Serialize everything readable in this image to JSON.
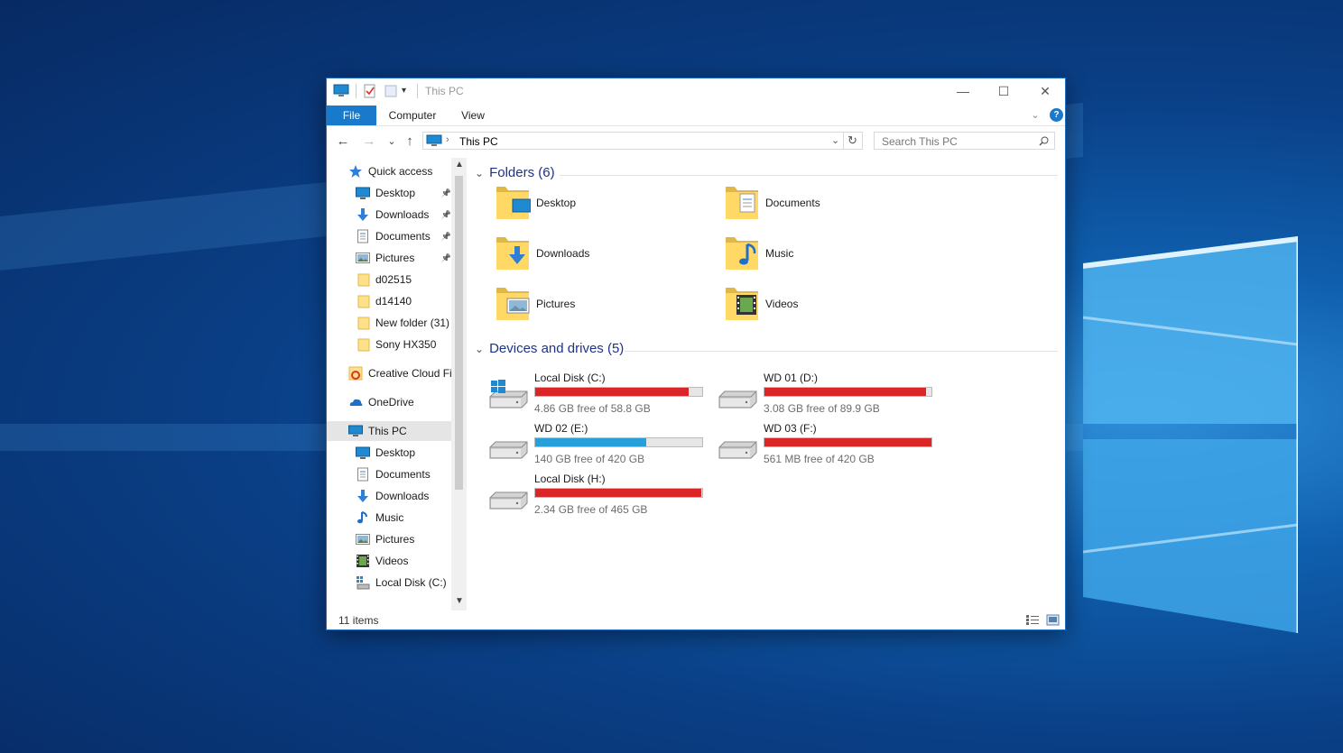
{
  "window": {
    "title": "This PC",
    "controls": {
      "minimize": "—",
      "maximize": "☐",
      "close": "✕"
    }
  },
  "ribbon": {
    "tabs": [
      "File",
      "Computer",
      "View"
    ],
    "help": "?"
  },
  "nav": {
    "back": "←",
    "forward": "→",
    "recent": "⌄",
    "up": "↑",
    "breadcrumb": "This PC",
    "refresh": "↻",
    "search_placeholder": "Search This PC"
  },
  "sidebar": {
    "items": [
      {
        "label": "Quick access",
        "icon": "star-icon",
        "level": 0
      },
      {
        "label": "Desktop",
        "icon": "desktop-icon",
        "level": 1,
        "pinned": true
      },
      {
        "label": "Downloads",
        "icon": "download-icon",
        "level": 1,
        "pinned": true
      },
      {
        "label": "Documents",
        "icon": "document-icon",
        "level": 1,
        "pinned": true
      },
      {
        "label": "Pictures",
        "icon": "picture-icon",
        "level": 1,
        "pinned": true
      },
      {
        "label": "d02515",
        "icon": "folder-icon",
        "level": 1
      },
      {
        "label": "d14140",
        "icon": "folder-icon",
        "level": 1
      },
      {
        "label": "New folder (31)",
        "icon": "folder-icon",
        "level": 1
      },
      {
        "label": "Sony HX350",
        "icon": "folder-icon",
        "level": 1
      },
      {
        "label": "Creative Cloud Fil",
        "icon": "creative-cloud-icon",
        "level": 0
      },
      {
        "label": "OneDrive",
        "icon": "onedrive-icon",
        "level": 0
      },
      {
        "label": "This PC",
        "icon": "computer-icon",
        "level": 0,
        "selected": true
      },
      {
        "label": "Desktop",
        "icon": "desktop-icon",
        "level": 1
      },
      {
        "label": "Documents",
        "icon": "document-icon",
        "level": 1
      },
      {
        "label": "Downloads",
        "icon": "download-icon",
        "level": 1
      },
      {
        "label": "Music",
        "icon": "music-icon",
        "level": 1
      },
      {
        "label": "Pictures",
        "icon": "picture-icon",
        "level": 1
      },
      {
        "label": "Videos",
        "icon": "video-icon",
        "level": 1
      },
      {
        "label": "Local Disk (C:)",
        "icon": "drive-icon",
        "level": 1
      }
    ]
  },
  "folders": {
    "header": "Folders (6)",
    "items": [
      "Desktop",
      "Documents",
      "Downloads",
      "Music",
      "Pictures",
      "Videos"
    ]
  },
  "drives": {
    "header": "Devices and drives (5)",
    "items": [
      {
        "name": "Local Disk (C:)",
        "free": "4.86 GB free of 58.8 GB",
        "used_fraction": 0.917,
        "bar_color": "#da2626",
        "windows": true
      },
      {
        "name": "WD 01 (D:)",
        "free": "3.08 GB free of 89.9 GB",
        "used_fraction": 0.966,
        "bar_color": "#da2626"
      },
      {
        "name": "WD 02 (E:)",
        "free": "140 GB free of 420 GB",
        "used_fraction": 0.667,
        "bar_color": "#26a0da"
      },
      {
        "name": "WD 03 (F:)",
        "free": "561 MB free of 420 GB",
        "used_fraction": 0.999,
        "bar_color": "#da2626"
      },
      {
        "name": "Local Disk (H:)",
        "free": "2.34 GB free of 465 GB",
        "used_fraction": 0.995,
        "bar_color": "#da2626"
      }
    ]
  },
  "status": {
    "items": "11 items"
  },
  "colors": {
    "accent": "#1979ca",
    "selected": "#e5e5e5",
    "header_text": "#1e3287"
  }
}
